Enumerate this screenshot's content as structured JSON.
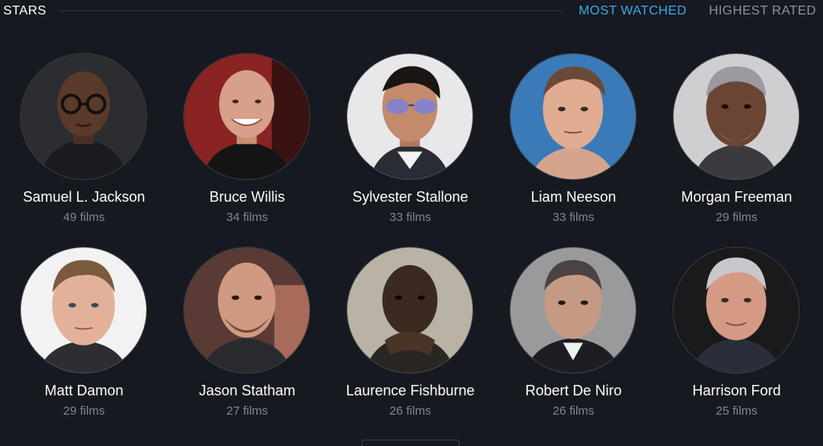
{
  "header": {
    "title": "STARS",
    "tabs": [
      {
        "label": "MOST WATCHED",
        "active": true
      },
      {
        "label": "HIGHEST RATED",
        "active": false
      }
    ]
  },
  "colors": {
    "background": "#16191f",
    "accent": "#3ea6ec",
    "muted": "#7f8790"
  },
  "stars": [
    {
      "name": "Samuel L. Jackson",
      "films": "49 films"
    },
    {
      "name": "Bruce Willis",
      "films": "34 films"
    },
    {
      "name": "Sylvester Stallone",
      "films": "33 films"
    },
    {
      "name": "Liam Neeson",
      "films": "33 films"
    },
    {
      "name": "Morgan Freeman",
      "films": "29 films"
    },
    {
      "name": "Matt Damon",
      "films": "29 films"
    },
    {
      "name": "Jason Statham",
      "films": "27 films"
    },
    {
      "name": "Laurence Fishburne",
      "films": "26 films"
    },
    {
      "name": "Robert De Niro",
      "films": "26 films"
    },
    {
      "name": "Harrison Ford",
      "films": "25 films"
    }
  ]
}
